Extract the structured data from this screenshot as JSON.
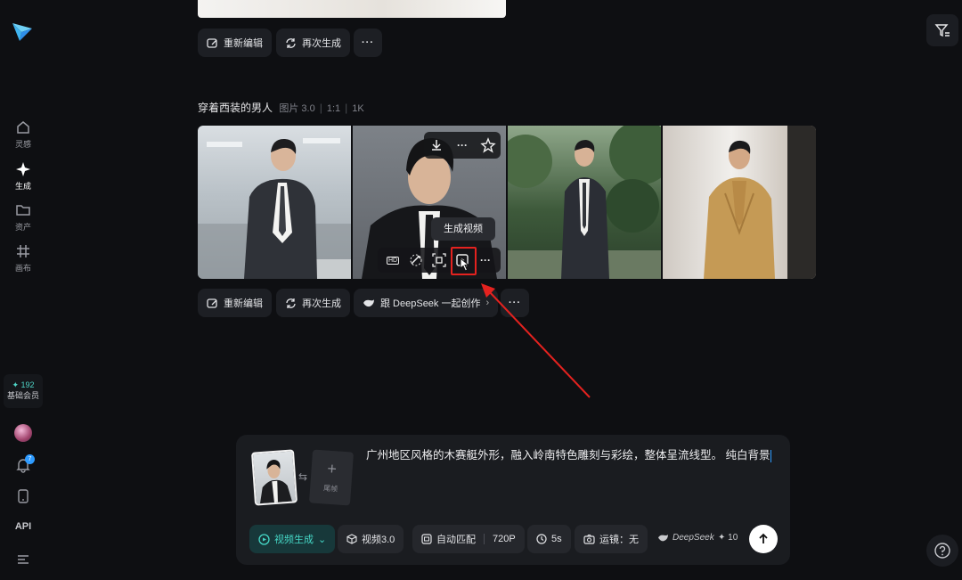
{
  "sidebar": {
    "items": [
      {
        "label": "灵感",
        "icon": "home-icon"
      },
      {
        "label": "生成",
        "icon": "sparkle-icon"
      },
      {
        "label": "资产",
        "icon": "folder-icon"
      },
      {
        "label": "画布",
        "icon": "grid-icon"
      }
    ],
    "credits_value": "✦ 192",
    "membership": "基础会员",
    "notification_count": "7",
    "api_label": "API"
  },
  "top_actions": {
    "reedit": "重新编辑",
    "regenerate": "再次生成"
  },
  "generation": {
    "title": "穿着西装的男人",
    "type": "图片 3.0",
    "ratio": "1:1",
    "resolution": "1K",
    "tooltip": "生成视频",
    "hd_label": "HD",
    "reedit": "重新编辑",
    "regenerate": "再次生成",
    "deepseek_cta": "跟 DeepSeek 一起创作"
  },
  "composer": {
    "tail_label": "尾帧",
    "prompt": "广州地区风格的木赛艇外形，融入岭南特色雕刻与彩绘，整体呈流线型。 纯白背景",
    "mode": "视频生成",
    "model": "视频3.0",
    "aspect": "自动匹配",
    "quality": "720P",
    "duration": "5s",
    "camera": "运镜：无",
    "deepseek": "DeepSeek",
    "cost": "✦ 10"
  },
  "colors": {
    "accent": "#45d7c6",
    "highlight": "#e4221f",
    "background": "#0e0f12"
  }
}
